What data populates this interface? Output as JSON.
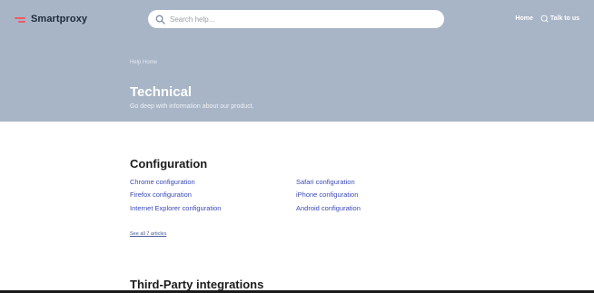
{
  "header": {
    "brand": "Smartproxy",
    "search_placeholder": "Search help...",
    "nav": {
      "home": "Home",
      "talk": "Talk to us"
    }
  },
  "hero": {
    "breadcrumb": "Help Home",
    "title": "Technical",
    "subtitle": "Go deep with information about our product."
  },
  "sections": [
    {
      "title": "Configuration",
      "articles_left": [
        "Chrome configuration",
        "Firefox configuration",
        "Internet Explorer configuration"
      ],
      "articles_right": [
        "Safari configuration",
        "iPhone configuration",
        "Android configuration"
      ],
      "see_all": "See all 7 articles"
    },
    {
      "title": "Third-Party integrations"
    }
  ],
  "colors": {
    "hero_bg": "#a8b5c7",
    "link": "#3b4ab5",
    "brand_accent": "#f05a63"
  }
}
